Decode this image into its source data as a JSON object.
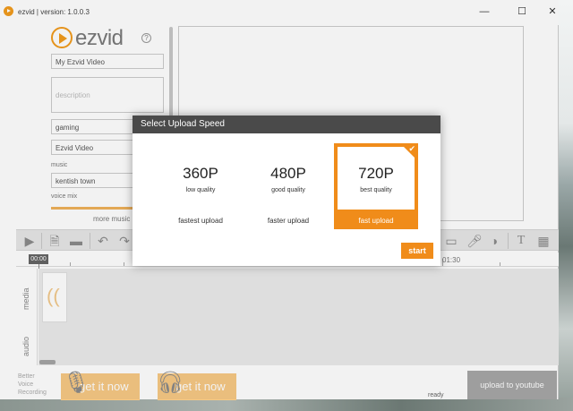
{
  "window": {
    "title": "ezvid | version: 1.0.0.3",
    "minimize": "—",
    "maximize": "☐",
    "close": "✕"
  },
  "brand": {
    "name": "ezvid",
    "help": "?"
  },
  "left_panel": {
    "title_value": "My Ezvid Video",
    "description_placeholder": "description",
    "category_value": "gaming",
    "tags_value": "Ezvid Video",
    "music_label": "music",
    "music_value": "kentish town",
    "voice_mix_label": "voice mix",
    "more_music": "more music"
  },
  "timeline": {
    "playhead_time": "00:00",
    "marker_time": "01:30",
    "media_label": "media",
    "audio_label": "audio"
  },
  "bottom": {
    "better_voice": [
      "Better",
      "Voice",
      "Recording"
    ],
    "get_it_1": "get it now",
    "get_it_2": "get it now",
    "status": "ready",
    "upload": "upload to youtube"
  },
  "modal": {
    "title": "Select Upload Speed",
    "options": [
      {
        "res": "360P",
        "quality": "low quality",
        "speed": "fastest upload"
      },
      {
        "res": "480P",
        "quality": "good quality",
        "speed": "faster upload"
      },
      {
        "res": "720P",
        "quality": "best quality",
        "speed": "fast upload",
        "selected": true
      }
    ],
    "start": "start"
  },
  "colors": {
    "accent": "#f08c1a",
    "accent_light": "#f7c984",
    "header": "#4a4a4a"
  }
}
